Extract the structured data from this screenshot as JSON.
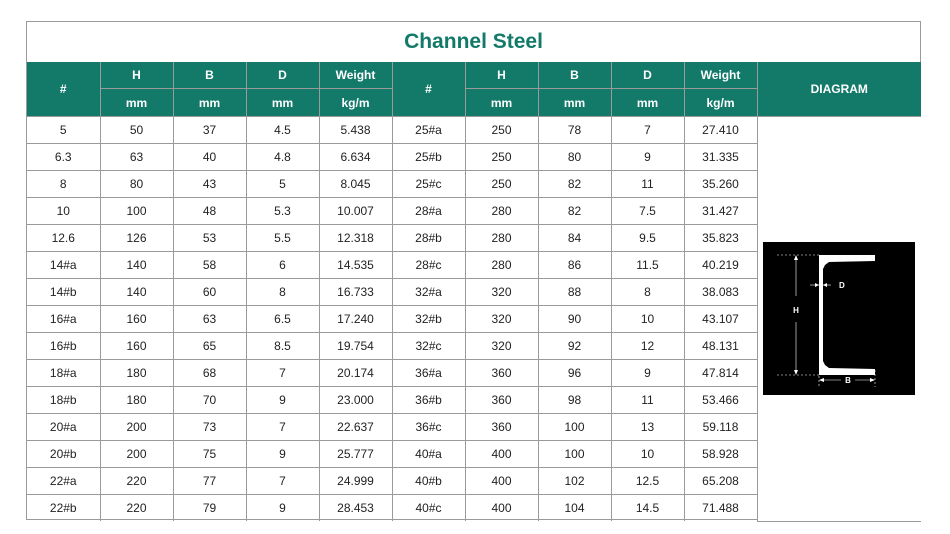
{
  "title": "Channel Steel",
  "headers": {
    "hash": "#",
    "h": "H",
    "b": "B",
    "d": "D",
    "weight": "Weight",
    "unit_mm": "mm",
    "unit_kgm": "kg/m",
    "diagram": "DIAGRAM"
  },
  "diagram_labels": {
    "h": "H",
    "b": "B",
    "d": "D"
  },
  "rows": [
    {
      "a": [
        "5",
        "50",
        "37",
        "4.5",
        "5.438"
      ],
      "b": [
        "25#a",
        "250",
        "78",
        "7",
        "27.410"
      ]
    },
    {
      "a": [
        "6.3",
        "63",
        "40",
        "4.8",
        "6.634"
      ],
      "b": [
        "25#b",
        "250",
        "80",
        "9",
        "31.335"
      ]
    },
    {
      "a": [
        "8",
        "80",
        "43",
        "5",
        "8.045"
      ],
      "b": [
        "25#c",
        "250",
        "82",
        "11",
        "35.260"
      ]
    },
    {
      "a": [
        "10",
        "100",
        "48",
        "5.3",
        "10.007"
      ],
      "b": [
        "28#a",
        "280",
        "82",
        "7.5",
        "31.427"
      ]
    },
    {
      "a": [
        "12.6",
        "126",
        "53",
        "5.5",
        "12.318"
      ],
      "b": [
        "28#b",
        "280",
        "84",
        "9.5",
        "35.823"
      ]
    },
    {
      "a": [
        "14#a",
        "140",
        "58",
        "6",
        "14.535"
      ],
      "b": [
        "28#c",
        "280",
        "86",
        "11.5",
        "40.219"
      ]
    },
    {
      "a": [
        "14#b",
        "140",
        "60",
        "8",
        "16.733"
      ],
      "b": [
        "32#a",
        "320",
        "88",
        "8",
        "38.083"
      ]
    },
    {
      "a": [
        "16#a",
        "160",
        "63",
        "6.5",
        "17.240"
      ],
      "b": [
        "32#b",
        "320",
        "90",
        "10",
        "43.107"
      ]
    },
    {
      "a": [
        "16#b",
        "160",
        "65",
        "8.5",
        "19.754"
      ],
      "b": [
        "32#c",
        "320",
        "92",
        "12",
        "48.131"
      ]
    },
    {
      "a": [
        "18#a",
        "180",
        "68",
        "7",
        "20.174"
      ],
      "b": [
        "36#a",
        "360",
        "96",
        "9",
        "47.814"
      ]
    },
    {
      "a": [
        "18#b",
        "180",
        "70",
        "9",
        "23.000"
      ],
      "b": [
        "36#b",
        "360",
        "98",
        "11",
        "53.466"
      ]
    },
    {
      "a": [
        "20#a",
        "200",
        "73",
        "7",
        "22.637"
      ],
      "b": [
        "36#c",
        "360",
        "100",
        "13",
        "59.118"
      ]
    },
    {
      "a": [
        "20#b",
        "200",
        "75",
        "9",
        "25.777"
      ],
      "b": [
        "40#a",
        "400",
        "100",
        "10",
        "58.928"
      ]
    },
    {
      "a": [
        "22#a",
        "220",
        "77",
        "7",
        "24.999"
      ],
      "b": [
        "40#b",
        "400",
        "102",
        "12.5",
        "65.208"
      ]
    },
    {
      "a": [
        "22#b",
        "220",
        "79",
        "9",
        "28.453"
      ],
      "b": [
        "40#c",
        "400",
        "104",
        "14.5",
        "71.488"
      ]
    }
  ],
  "colors": {
    "header_bg": "#137a6a",
    "title": "#137a6a",
    "border": "#9a9a9a"
  }
}
